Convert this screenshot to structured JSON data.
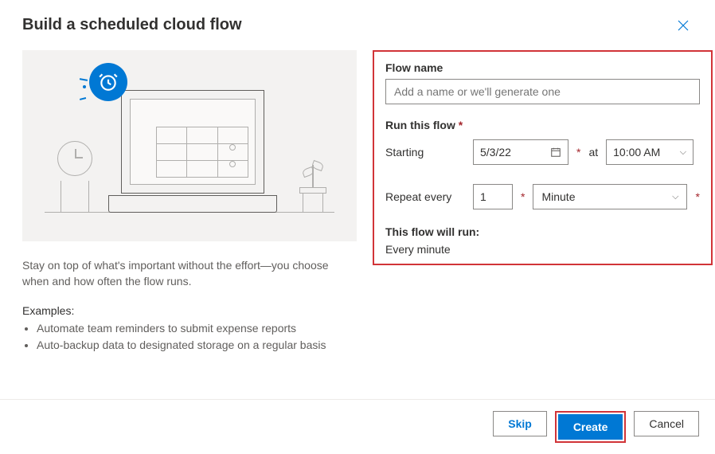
{
  "dialog": {
    "title": "Build a scheduled cloud flow"
  },
  "illustration": {
    "badge_icon": "alarm-clock-icon"
  },
  "description": "Stay on top of what's important without the effort—you choose when and how often the flow runs.",
  "examples_label": "Examples:",
  "examples": [
    "Automate team reminders to submit expense reports",
    "Auto-backup data to designated storage on a regular basis"
  ],
  "form": {
    "flow_name_label": "Flow name",
    "flow_name_placeholder": "Add a name or we'll generate one",
    "run_label": "Run this flow",
    "starting_label": "Starting",
    "starting_date": "5/3/22",
    "at_label": "at",
    "starting_time": "10:00 AM",
    "repeat_label": "Repeat every",
    "repeat_value": "1",
    "repeat_unit": "Minute",
    "summary_label": "This flow will run:",
    "summary_value": "Every minute"
  },
  "footer": {
    "skip": "Skip",
    "create": "Create",
    "cancel": "Cancel"
  }
}
